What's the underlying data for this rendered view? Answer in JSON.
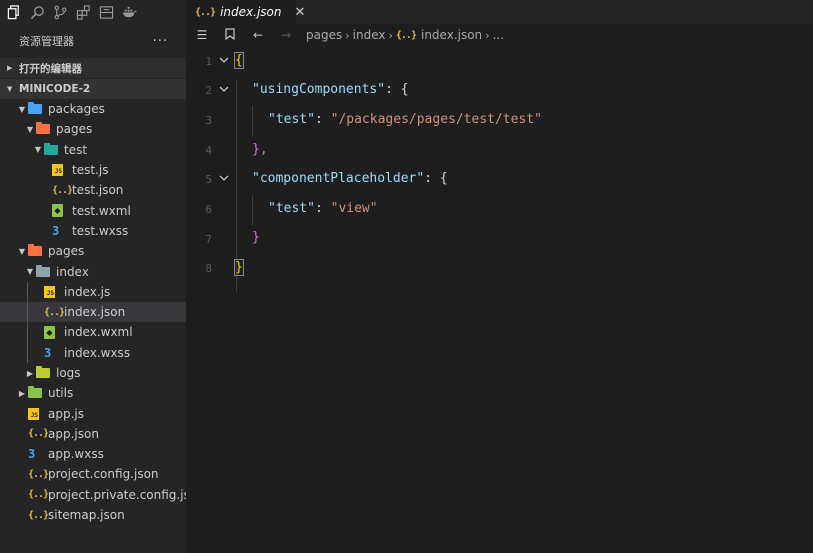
{
  "tab": {
    "title": "index.json",
    "icon": "json-icon",
    "close": "✕"
  },
  "breadcrumb": {
    "items": [
      "pages",
      "index",
      "index.json",
      "..."
    ]
  },
  "explorer": {
    "title": "资源管理器",
    "more": "···",
    "sections": {
      "open_editors": "打开的编辑器",
      "project": "MINICODE-2"
    },
    "tree": [
      {
        "label": "packages",
        "type": "folder",
        "depth": 1,
        "expanded": true,
        "color": "#42a5f5"
      },
      {
        "label": "pages",
        "type": "folder",
        "depth": 2,
        "expanded": true,
        "color": "#ff7043"
      },
      {
        "label": "test",
        "type": "folder",
        "depth": 3,
        "expanded": true,
        "color": "#26a69a"
      },
      {
        "label": "test.js",
        "type": "js",
        "depth": 4
      },
      {
        "label": "test.json",
        "type": "json",
        "depth": 4
      },
      {
        "label": "test.wxml",
        "type": "wxml",
        "depth": 4
      },
      {
        "label": "test.wxss",
        "type": "wxss",
        "depth": 4
      },
      {
        "label": "pages",
        "type": "folder",
        "depth": 1,
        "expanded": true,
        "color": "#ff7043"
      },
      {
        "label": "index",
        "type": "folder",
        "depth": 2,
        "expanded": true,
        "color": "#90a4ae"
      },
      {
        "label": "index.js",
        "type": "js",
        "depth": 3
      },
      {
        "label": "index.json",
        "type": "json",
        "depth": 3,
        "selected": true
      },
      {
        "label": "index.wxml",
        "type": "wxml",
        "depth": 3
      },
      {
        "label": "index.wxss",
        "type": "wxss",
        "depth": 3
      },
      {
        "label": "logs",
        "type": "folder",
        "depth": 2,
        "expanded": false,
        "color": "#c0ca33"
      },
      {
        "label": "utils",
        "type": "folder",
        "depth": 1,
        "expanded": false,
        "color": "#8bc34a"
      },
      {
        "label": "app.js",
        "type": "js",
        "depth": 1
      },
      {
        "label": "app.json",
        "type": "json",
        "depth": 1
      },
      {
        "label": "app.wxss",
        "type": "wxss",
        "depth": 1
      },
      {
        "label": "project.config.json",
        "type": "json",
        "depth": 1
      },
      {
        "label": "project.private.config.js...",
        "type": "json",
        "depth": 1
      },
      {
        "label": "sitemap.json",
        "type": "json",
        "depth": 1
      }
    ]
  },
  "editor": {
    "lines": [
      {
        "n": "1",
        "fold": true
      },
      {
        "n": "2",
        "fold": true
      },
      {
        "n": "3",
        "fold": false
      },
      {
        "n": "4",
        "fold": false
      },
      {
        "n": "5",
        "fold": true
      },
      {
        "n": "6",
        "fold": false
      },
      {
        "n": "7",
        "fold": false
      },
      {
        "n": "8",
        "fold": false
      }
    ],
    "code": {
      "open_brace": "{",
      "key_using": "\"usingComponents\"",
      "key_test": "\"test\"",
      "val_path": "\"/packages/pages/test/test\"",
      "key_placeholder": "\"componentPlaceholder\"",
      "val_view": "\"view\"",
      "close_inner_comma": "},",
      "close_inner": "}",
      "close_brace": "}",
      "colon_open": ": {",
      "colon": ": "
    }
  },
  "colors": {
    "selection": "#37373d",
    "key": "#9cdcfe",
    "string": "#ce9178"
  }
}
